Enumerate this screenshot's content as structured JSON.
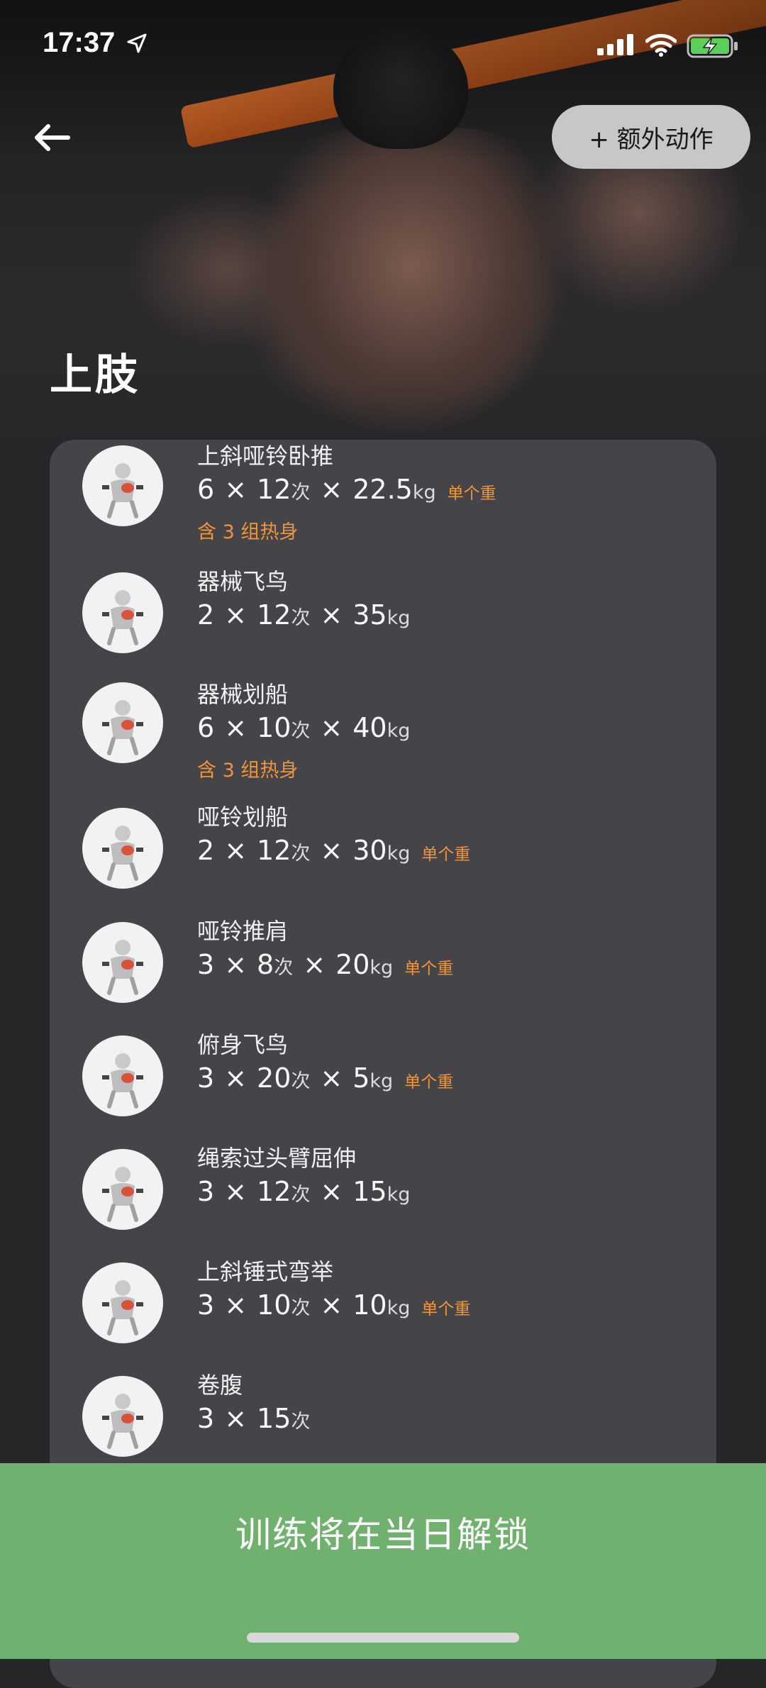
{
  "status_bar": {
    "time": "17:37"
  },
  "header": {
    "extra_button_label": "+ 额外动作"
  },
  "page_title": "上肢",
  "exercises": [
    {
      "name": "上斜哑铃卧推",
      "sets": "6",
      "reps": "12",
      "rep_unit": "次",
      "weight": "22.5",
      "weight_unit": "kg",
      "note": "单个重",
      "warmup": "含 3 组热身"
    },
    {
      "name": "器械飞鸟",
      "sets": "2",
      "reps": "12",
      "rep_unit": "次",
      "weight": "35",
      "weight_unit": "kg",
      "note": "",
      "warmup": ""
    },
    {
      "name": "器械划船",
      "sets": "6",
      "reps": "10",
      "rep_unit": "次",
      "weight": "40",
      "weight_unit": "kg",
      "note": "",
      "warmup": "含 3 组热身"
    },
    {
      "name": "哑铃划船",
      "sets": "2",
      "reps": "12",
      "rep_unit": "次",
      "weight": "30",
      "weight_unit": "kg",
      "note": "单个重",
      "warmup": ""
    },
    {
      "name": "哑铃推肩",
      "sets": "3",
      "reps": "8",
      "rep_unit": "次",
      "weight": "20",
      "weight_unit": "kg",
      "note": "单个重",
      "warmup": ""
    },
    {
      "name": "俯身飞鸟",
      "sets": "3",
      "reps": "20",
      "rep_unit": "次",
      "weight": "5",
      "weight_unit": "kg",
      "note": "单个重",
      "warmup": ""
    },
    {
      "name": "绳索过头臂屈伸",
      "sets": "3",
      "reps": "12",
      "rep_unit": "次",
      "weight": "15",
      "weight_unit": "kg",
      "note": "",
      "warmup": ""
    },
    {
      "name": "上斜锤式弯举",
      "sets": "3",
      "reps": "10",
      "rep_unit": "次",
      "weight": "10",
      "weight_unit": "kg",
      "note": "单个重",
      "warmup": ""
    },
    {
      "name": "卷腹",
      "sets": "3",
      "reps": "15",
      "rep_unit": "次",
      "weight": "",
      "weight_unit": "",
      "note": "",
      "warmup": ""
    }
  ],
  "unlock_label": "训练将在当日解锁",
  "colors": {
    "accent_orange": "#f0963a",
    "unlock_green": "#70b170",
    "card_bg": "#454449"
  },
  "icons": [
    "location-arrow-icon",
    "cellular-signal-icon",
    "wifi-icon",
    "battery-charging-icon",
    "back-arrow-icon",
    "exercise-illustration-icon"
  ]
}
